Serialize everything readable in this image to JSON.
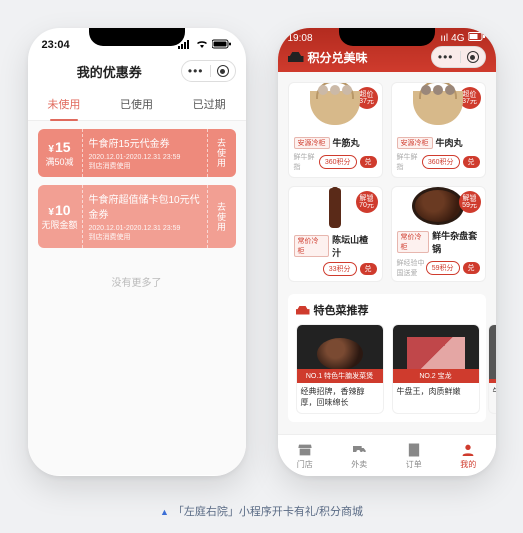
{
  "left": {
    "status_time": "23:04",
    "header_title": "我的优惠券",
    "tabs": [
      "未使用",
      "已使用",
      "已过期"
    ],
    "coupons": [
      {
        "amount": "15",
        "amount_sub": "满50减",
        "title": "牛食府15元代金券",
        "desc1": "2020.12.01-2020.12.31 23:59",
        "desc2": "到店消费使用",
        "action": "去使用"
      },
      {
        "amount": "10",
        "amount_sub": "无限金额",
        "title": "牛食府超值储卡包10元代金券",
        "desc1": "2020.12.01-2020.12.31 23:59",
        "desc2": "到店消费使用",
        "action": "去使用"
      }
    ],
    "empty_text": "没有更多了"
  },
  "right": {
    "status_time": "19:08",
    "status_carrier": "4G",
    "header_title": "积分兑美味",
    "products": [
      {
        "badge": "超价\n37元",
        "tag": "安源冷柜",
        "name": "牛筋丸",
        "sub": "鲜牛鲜指",
        "points": "360积分",
        "btn": "兑"
      },
      {
        "badge": "超价\n37元",
        "tag": "安源冷柜",
        "name": "牛肉丸",
        "sub": "鲜牛鲜指",
        "points": "360积分",
        "btn": "兑"
      },
      {
        "badge": "解锁\n70元",
        "tag": "常价冷柜",
        "name": "陈坛山楂汁",
        "sub": "",
        "points": "33积分",
        "btn": "兑"
      },
      {
        "badge": "解锁\n59元",
        "tag": "常价冷柜",
        "name": "鲜牛杂盘套锅",
        "sub": "鲜经验中国送爱",
        "points": "59积分",
        "btn": "兑"
      }
    ],
    "section_title": "特色菜推荐",
    "dishes": [
      {
        "banner": "NO.1 特色牛腩发菜煲",
        "line1": "经典招牌，香辣醇厚，回味绵长",
        "line2": ""
      },
      {
        "banner": "NO.2 宝龙",
        "line1": "牛盘王，肉质鲜嫩",
        "line2": ""
      },
      {
        "banner": "",
        "line1": "牛",
        "line2": ""
      }
    ],
    "nav": [
      {
        "label": "门店"
      },
      {
        "label": "外卖"
      },
      {
        "label": "订单"
      },
      {
        "label": "我的"
      }
    ]
  },
  "caption": "「左庭右院」小程序开卡有礼/积分商城"
}
